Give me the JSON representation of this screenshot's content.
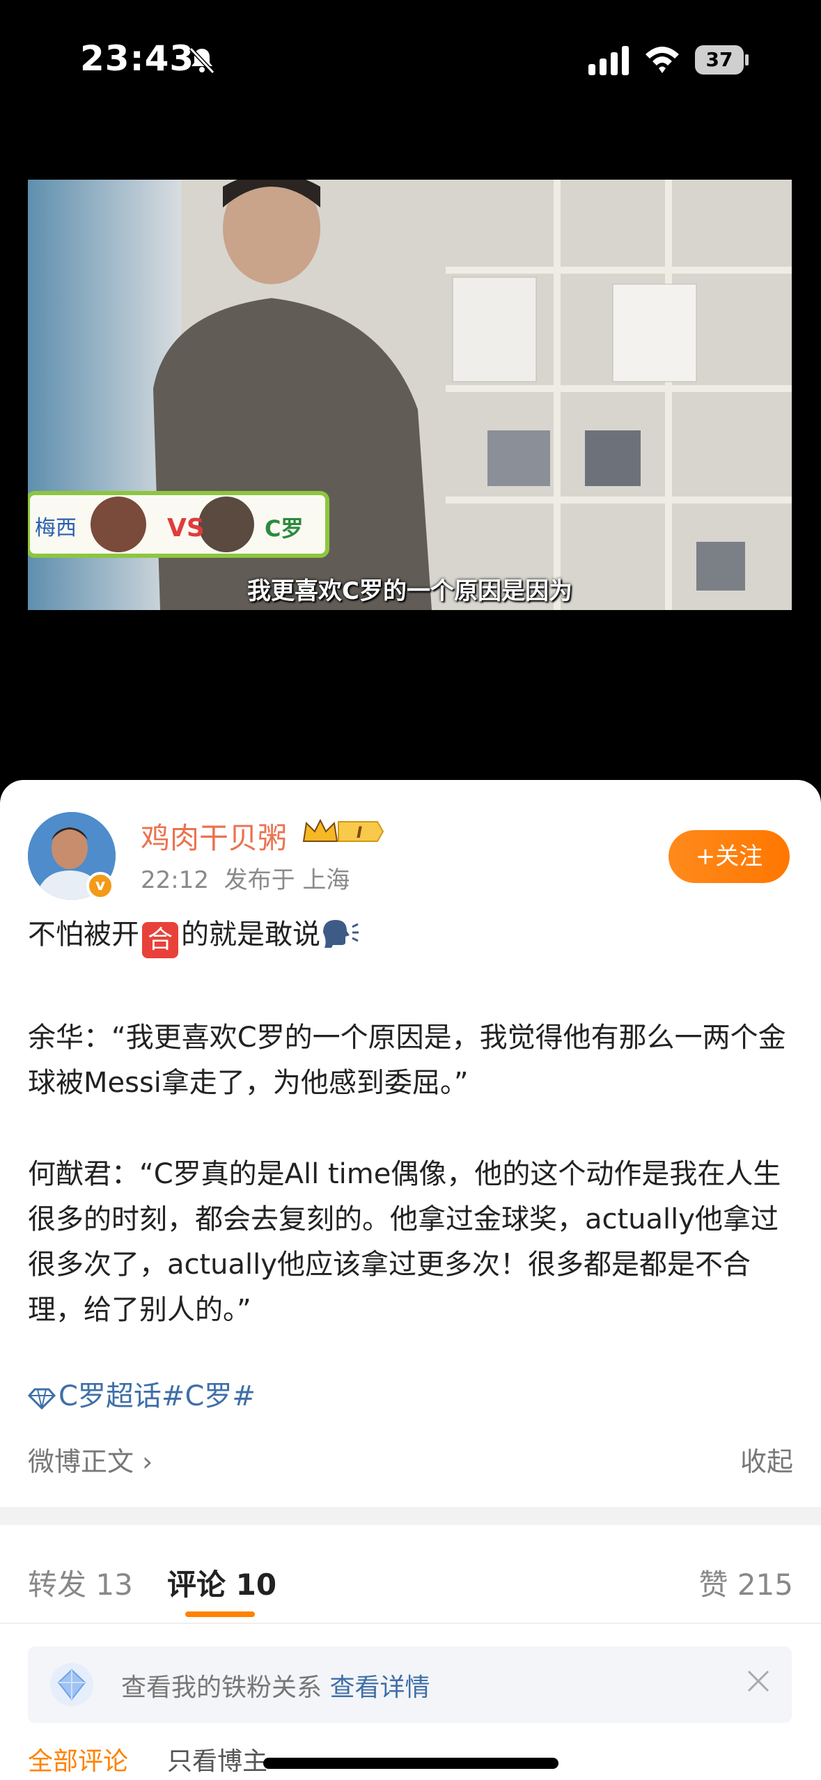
{
  "status_bar": {
    "time": "23:43",
    "battery": "37"
  },
  "video": {
    "subtitle": "我更喜欢C罗的一个原因是因为",
    "left_label": "梅西",
    "right_label": "C罗",
    "vs": "VS"
  },
  "author": {
    "name": "鸡肉干贝粥",
    "level": "I",
    "time": "22:12",
    "location_text": "发布于 上海",
    "follow_label": "+关注"
  },
  "post": {
    "line1_before": "不怕被开",
    "line1_badge": "合",
    "line1_after": "的就是敢说",
    "para2": "余华：“我更喜欢C罗的一个原因是，我觉得他有那么一两个金球被Messi拿走了，为他感到委屈。”",
    "para3": "何猷君：“C罗真的是All time偶像，他的这个动作是我在人生很多的时刻，都会去复刻的。他拿过金球奖，actually他拿过很多次了，actually他应该拿过更多次！很多都是都是不合理，给了别人的。”",
    "topic": "C罗超话#C罗#",
    "full_text": "微博正文 ›",
    "collapse": "收起"
  },
  "tabs": {
    "repost": "转发 13",
    "comment": "评论 10",
    "like": "赞 215"
  },
  "fans_banner": {
    "text": "查看我的铁粉关系",
    "link": "查看详情"
  },
  "filters": {
    "all": "全部评论",
    "blogger_only": "只看博主"
  },
  "colors": {
    "accent": "#ff8200",
    "username": "#eb7350",
    "link": "#3f6fa8"
  }
}
